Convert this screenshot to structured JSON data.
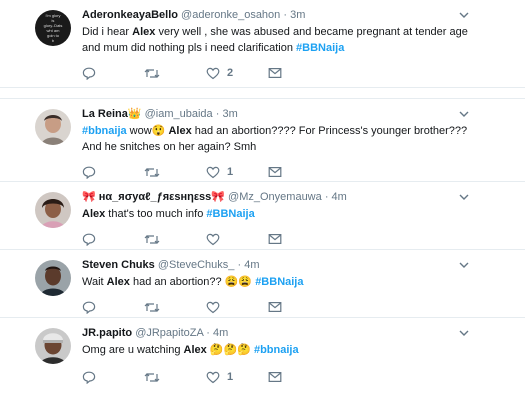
{
  "tweets": [
    {
      "name": "AderonkeayaBello",
      "handle": "@aderonke_osahon",
      "time": "3m",
      "avatar_text": [
        "I'm glory",
        "is",
        "glory..Dats",
        "wht am",
        "goin to",
        "b"
      ],
      "text_pre": "Did i hear ",
      "highlight": "Alex",
      "text_post": " very well , she was abused and became pregnant at tender age and mum did nothing pls i need clarification ",
      "hashtag": "#BBNaija",
      "like_count": "2",
      "retweet_count": ""
    },
    {
      "name": "La Reina",
      "name_emoji": "👑",
      "handle": "@iam_ubaida",
      "time": "3m",
      "hashtag_lead": "#bbnaija",
      "text_a": " wow",
      "emoji_a": "😲",
      "highlight": "Alex",
      "text_post": " had an abortion???? For Princess's younger brother??? And he snitches on her again? Smh",
      "like_count": "1",
      "retweet_count": ""
    },
    {
      "name": "🎀 нα_яσуαℓ_ƒяεѕнηεѕѕ🎀",
      "handle": "@Mz_Onyemauwa",
      "time": "4m",
      "highlight": "Alex",
      "text_post": " that's too much info  ",
      "hashtag": "#BBNaija",
      "like_count": "",
      "retweet_count": ""
    },
    {
      "name": "Steven Chuks",
      "handle": "@SteveChuks_",
      "time": "4m",
      "text_pre": "Wait ",
      "highlight": "Alex",
      "text_post": " had an abortion?? ",
      "emojis": "😩😩",
      "hashtag": "#BBNaija",
      "like_count": "",
      "retweet_count": ""
    },
    {
      "name": "JR.papito",
      "handle": "@JRpapitoZA",
      "time": "4m",
      "text_pre": "Omg are u watching ",
      "highlight": "Alex",
      "emojis": "🤔🤔🤔",
      "hashtag": "#bbnaija",
      "like_count": "1",
      "retweet_count": ""
    }
  ],
  "dot": "·",
  "icons": {
    "reply": "reply-icon",
    "retweet": "retweet-icon",
    "like": "heart-icon",
    "dm": "envelope-icon",
    "caret": "chevron-down-icon"
  },
  "colors": {
    "hashtag": "#1da1f2",
    "muted": "#657786",
    "divider": "#e6ecf0",
    "text": "#14171a"
  }
}
